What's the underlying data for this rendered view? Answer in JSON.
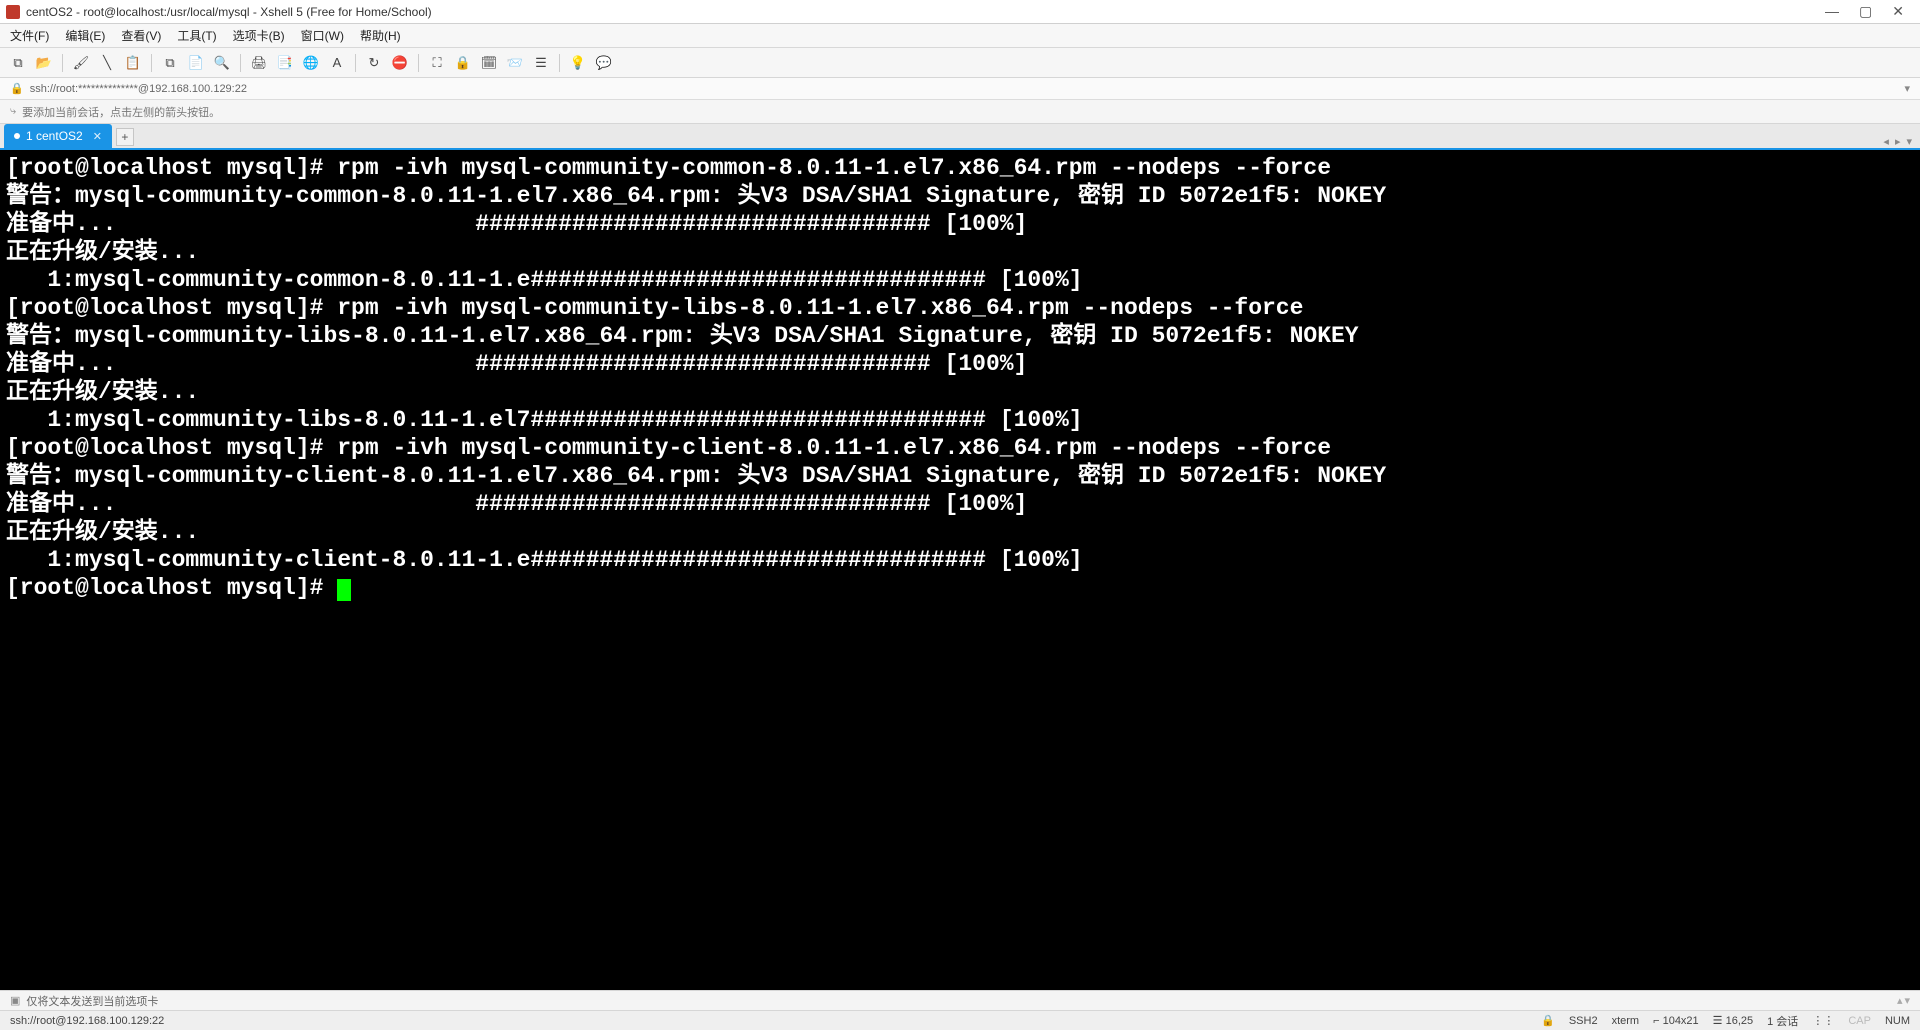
{
  "window": {
    "title": "centOS2 - root@localhost:/usr/local/mysql - Xshell 5 (Free for Home/School)"
  },
  "menu": {
    "file": "文件(F)",
    "edit": "编辑(E)",
    "view": "查看(V)",
    "tools": "工具(T)",
    "tabs": "选项卡(B)",
    "window": "窗口(W)",
    "help": "帮助(H)"
  },
  "address": {
    "value": "ssh://root:**************@192.168.100.129:22"
  },
  "hint": {
    "text": "要添加当前会话，点击左侧的箭头按钮。"
  },
  "tab": {
    "label": "1 centOS2"
  },
  "terminal": {
    "lines": [
      "[root@localhost mysql]# rpm -ivh mysql-community-common-8.0.11-1.el7.x86_64.rpm --nodeps --force",
      "警告：mysql-community-common-8.0.11-1.el7.x86_64.rpm: 头V3 DSA/SHA1 Signature, 密钥 ID 5072e1f5: NOKEY",
      "准备中...                          ################################# [100%]",
      "正在升级/安装...",
      "   1:mysql-community-common-8.0.11-1.e################################# [100%]",
      "[root@localhost mysql]# rpm -ivh mysql-community-libs-8.0.11-1.el7.x86_64.rpm --nodeps --force",
      "警告：mysql-community-libs-8.0.11-1.el7.x86_64.rpm: 头V3 DSA/SHA1 Signature, 密钥 ID 5072e1f5: NOKEY",
      "准备中...                          ################################# [100%]",
      "正在升级/安装...",
      "   1:mysql-community-libs-8.0.11-1.el7################################# [100%]",
      "[root@localhost mysql]# rpm -ivh mysql-community-client-8.0.11-1.el7.x86_64.rpm --nodeps --force",
      "警告：mysql-community-client-8.0.11-1.el7.x86_64.rpm: 头V3 DSA/SHA1 Signature, 密钥 ID 5072e1f5: NOKEY",
      "准备中...                          ################################# [100%]",
      "正在升级/安装...",
      "   1:mysql-community-client-8.0.11-1.e################################# [100%]",
      "[root@localhost mysql]# "
    ]
  },
  "bottom_hint": {
    "text": "仅将文本发送到当前选项卡"
  },
  "status": {
    "left": "ssh://root@192.168.100.129:22",
    "ssh": "SSH2",
    "term": "xterm",
    "size": "104x21",
    "pos": "16,25",
    "session": "1 会话",
    "cap": "CAP",
    "num": "NUM"
  },
  "icons": {
    "new": "⧉",
    "open": "📂",
    "paint": "🖌",
    "props": "📋",
    "copy": "⧉",
    "paste": "📄",
    "find": "🔍",
    "print": "🖨",
    "clip": "📑",
    "globe": "🌐",
    "font": "A",
    "refresh": "↻",
    "stop": "⛔",
    "full": "⛶",
    "lock": "🔒",
    "cal": "🗓",
    "send": "📨",
    "rows": "☰",
    "lamp": "💡",
    "chat": "💬"
  }
}
